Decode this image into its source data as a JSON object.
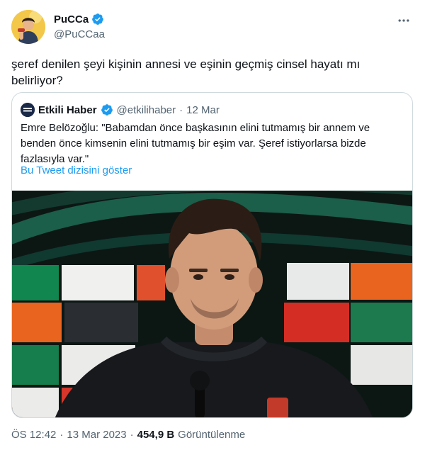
{
  "author": {
    "display_name": "PuCCa",
    "handle": "@PuCCaa"
  },
  "more_icon": "more-horizontal-icon",
  "tweet_text": "şeref denilen şeyi kişinin annesi ve eşinin geçmiş cinsel hayatı mı belirliyor?",
  "quote": {
    "display_name": "Etkili Haber",
    "handle": "@etkilihaber",
    "separator": "·",
    "date": "12 Mar",
    "text": "Emre Belözoğlu: \"Babamdan önce başkasının elini tutmamış bir annem ve benden önce kimsenin elini tutmamış bir eşim var. Şeref istiyorlarsa bizde fazlasıyla var.\"",
    "thread_link": "Bu Tweet dizisini göster"
  },
  "footer": {
    "time": "ÖS 12:42",
    "dot1": "·",
    "date": "13 Mar 2023",
    "dot2": "·",
    "views_count": "454,9 B",
    "views_label": "Görüntülenme"
  },
  "colors": {
    "accent": "#1d9bf0",
    "text": "#0f1419",
    "muted": "#536471",
    "border": "#cfd9de"
  }
}
